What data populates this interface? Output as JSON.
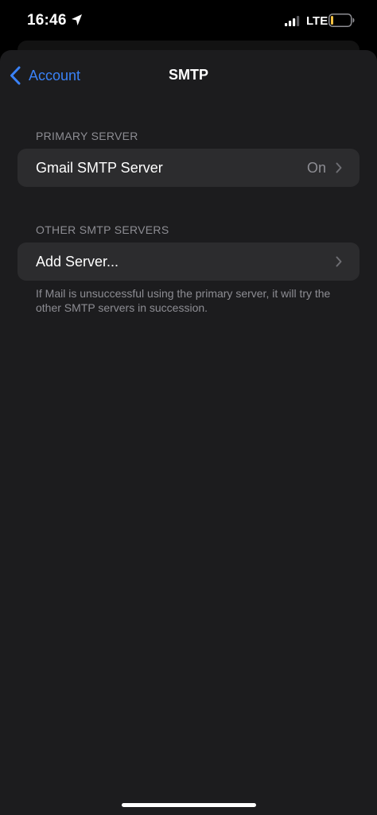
{
  "status_bar": {
    "time": "16:46",
    "network": "LTE",
    "icons": [
      "location-arrow-icon",
      "cellular-signal-icon",
      "battery-icon"
    ]
  },
  "nav": {
    "back_label": "Account",
    "title": "SMTP"
  },
  "primary_section": {
    "header": "PRIMARY SERVER",
    "server_label": "Gmail SMTP Server",
    "server_value": "On"
  },
  "other_section": {
    "header": "OTHER SMTP SERVERS",
    "add_label": "Add Server...",
    "footer": "If Mail is unsuccessful using the primary server, it will try the other SMTP servers in succession."
  },
  "colors": {
    "accent": "#3a82f7",
    "background": "#1c1c1e",
    "cell": "#2c2c2e",
    "secondary_text": "#8d8d93",
    "battery_low": "#f5c242"
  }
}
